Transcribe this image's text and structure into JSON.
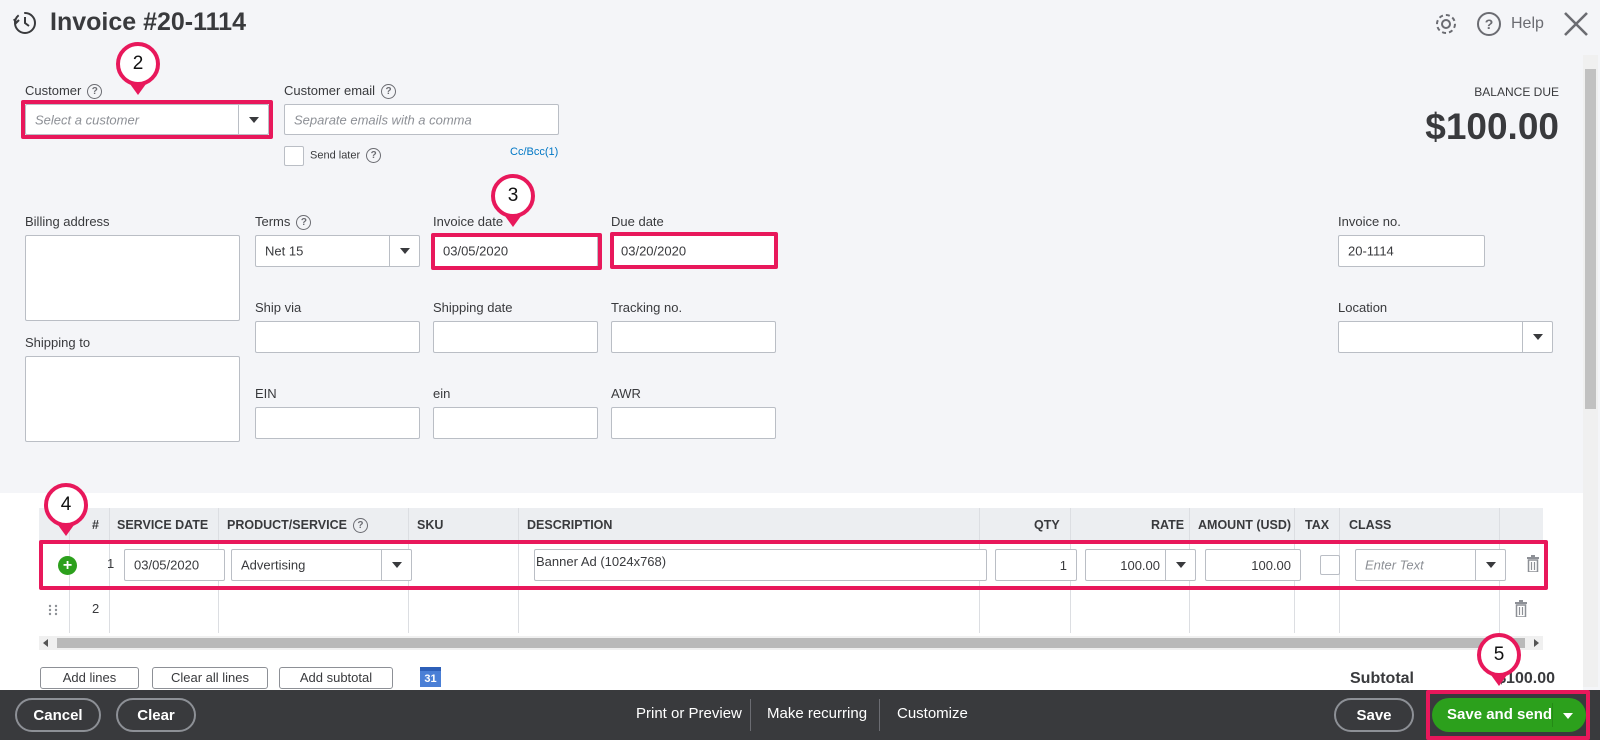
{
  "header": {
    "title": "Invoice #20-1114",
    "help_label": "Help"
  },
  "customer": {
    "label": "Customer",
    "placeholder": "Select a customer",
    "email_label": "Customer email",
    "email_placeholder": "Separate emails with a comma",
    "send_later_label": "Send later",
    "cc_bcc": "Cc/Bcc(1)"
  },
  "balance": {
    "label": "BALANCE DUE",
    "amount": "$100.00"
  },
  "form": {
    "billing_address_label": "Billing address",
    "shipping_to_label": "Shipping to",
    "terms_label": "Terms",
    "terms_value": "Net 15",
    "invoice_date_label": "Invoice date",
    "invoice_date_value": "03/05/2020",
    "due_date_label": "Due date",
    "due_date_value": "03/20/2020",
    "invoice_no_label": "Invoice no.",
    "invoice_no_value": "20-1114",
    "ship_via_label": "Ship via",
    "shipping_date_label": "Shipping date",
    "tracking_no_label": "Tracking no.",
    "location_label": "Location",
    "ein_label": "EIN",
    "ein_lower_label": "ein",
    "awr_label": "AWR"
  },
  "table": {
    "headers": {
      "num": "#",
      "service_date": "SERVICE DATE",
      "product_service": "PRODUCT/SERVICE",
      "sku": "SKU",
      "description": "DESCRIPTION",
      "qty": "QTY",
      "rate": "RATE",
      "amount": "AMOUNT (USD)",
      "tax": "TAX",
      "class": "CLASS"
    },
    "rows": [
      {
        "num": "1",
        "service_date": "03/05/2020",
        "product": "Advertising",
        "description": "Banner Ad (1024x768)",
        "qty": "1",
        "rate": "100.00",
        "amount": "100.00",
        "class_placeholder": "Enter Text"
      },
      {
        "num": "2"
      }
    ]
  },
  "actions": {
    "add_lines": "Add lines",
    "clear_all_lines": "Clear all lines",
    "add_subtotal": "Add subtotal",
    "calendar_day": "31"
  },
  "totals": {
    "subtotal_label": "Subtotal",
    "subtotal_value": "$100.00"
  },
  "footer": {
    "cancel": "Cancel",
    "clear": "Clear",
    "print_preview": "Print or Preview",
    "make_recurring": "Make recurring",
    "customize": "Customize",
    "save": "Save",
    "save_and_send": "Save and send"
  },
  "annotations": [
    "2",
    "3",
    "4",
    "5"
  ],
  "colors": {
    "highlight": "#e8185b",
    "primary_green": "#2ca01c",
    "footer_bg": "#393a3d",
    "link_blue": "#0077c5"
  }
}
